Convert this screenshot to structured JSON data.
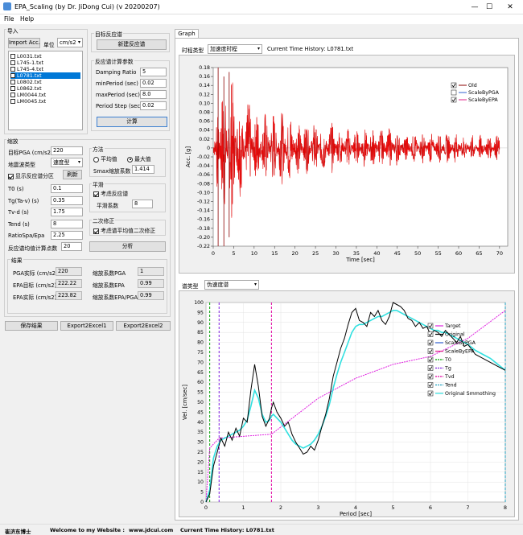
{
  "window": {
    "title": "EPA_Scaling (by Dr. JiDong Cui) (v 20200207)",
    "minimize": "—",
    "maximize": "☐",
    "close": "✕"
  },
  "menu": {
    "file": "File",
    "help": "Help"
  },
  "import": {
    "title": "导入",
    "import_btn": "Import Acc.",
    "unit_label": "单位",
    "unit_value": "cm/s2",
    "files": [
      {
        "name": "L0031.txt",
        "selected": false
      },
      {
        "name": "L745-1.txt",
        "selected": false
      },
      {
        "name": "L745-4.txt",
        "selected": false
      },
      {
        "name": "L0781.txt",
        "selected": true
      },
      {
        "name": "L0802.txt",
        "selected": false
      },
      {
        "name": "L0862.txt",
        "selected": false
      },
      {
        "name": "LM0044.txt",
        "selected": false
      },
      {
        "name": "LM0045.txt",
        "selected": false
      }
    ]
  },
  "target_spectrum": {
    "title": "目标反应谱",
    "new_btn": "新建反应谱"
  },
  "spec_params": {
    "title": "反应谱计算参数",
    "rows": [
      {
        "label": "Damping Ratio",
        "value": "5"
      },
      {
        "label": "minPeriod (sec)",
        "value": "0.02"
      },
      {
        "label": "maxPeriod (sec)",
        "value": "8.0"
      },
      {
        "label": "Period Step (sec)",
        "value": "0.02"
      }
    ],
    "calc_btn": "计算"
  },
  "scaling": {
    "title": "缩放",
    "target_pga_label": "目标PGA (cm/s2)",
    "target_pga": "220",
    "type_label": "地震波类型",
    "type_value": "速度型",
    "show_zone": "显示反应谱分区",
    "refresh_btn": "刷新",
    "params": [
      {
        "label": "T0 (s)",
        "value": "0.1"
      },
      {
        "label": "Tg(Ta-v) (s)",
        "value": "0.35"
      },
      {
        "label": "Tv-d (s)",
        "value": "1.75"
      },
      {
        "label": "Tend (s)",
        "value": "8"
      },
      {
        "label": "RatioSpa/Epa",
        "value": "2.25"
      }
    ],
    "npts_label": "反应谱均值计算点数",
    "npts": "20",
    "analyze_btn": "分析"
  },
  "method": {
    "title": "方法",
    "avg": "平均值",
    "max": "最大值",
    "smax_label": "Smax缩放系数",
    "smax": "1.414"
  },
  "smooth": {
    "title": "平滑",
    "consider": "考虑反应谱",
    "coef_label": "平滑系数",
    "coef": "8"
  },
  "secondary": {
    "title": "二次修正",
    "consider": "考虑谱平均值二次修正"
  },
  "results": {
    "title": "结果",
    "rows": [
      {
        "l1": "PGA实际 (cm/s2)",
        "v1": "220",
        "l2": "缩放系数PGA",
        "v2": "1"
      },
      {
        "l1": "EPA目标 (cm/s2)",
        "v1": "222.22",
        "l2": "缩放系数EPA",
        "v2": "0.99"
      },
      {
        "l1": "EPA实际 (cm/s2)",
        "v1": "223.82",
        "l2": "缩放系数EPA/PGA",
        "v2": "0.99"
      }
    ]
  },
  "bottom_buttons": {
    "save": "保存结果",
    "excel1": "Export2Excel1",
    "excel2": "Export2Excel2"
  },
  "graph": {
    "tab": "Graph",
    "history_type_label": "时程类型",
    "history_type": "加速度时程",
    "current_history": "Current Time History: L0781.txt",
    "spectrum_type_label": "谱类型",
    "spectrum_type": "伪速度谱"
  },
  "chart_data": [
    {
      "type": "line",
      "xlabel": "Time [sec]",
      "ylabel": "Acc. [g]",
      "xlim": [
        0,
        72
      ],
      "ylim": [
        -0.22,
        0.18
      ],
      "xticks": [
        0,
        5,
        10,
        15,
        20,
        25,
        30,
        35,
        40,
        45,
        50,
        55,
        60,
        65,
        70
      ],
      "yticks": [
        -0.22,
        -0.2,
        -0.18,
        -0.16,
        -0.14,
        -0.12,
        -0.1,
        -0.08,
        -0.06,
        -0.04,
        -0.02,
        0,
        0.02,
        0.04,
        0.06,
        0.08,
        0.1,
        0.12,
        0.14,
        0.16,
        0.18
      ],
      "legend_position": "top-right",
      "series": [
        {
          "name": "Old",
          "color": "#8b0000"
        },
        {
          "name": "ScaleByPGA",
          "color": "#3060d0"
        },
        {
          "name": "ScaleByEPA",
          "color": "#e0208a"
        }
      ],
      "colors": {
        "old": "#8b0000",
        "epa": "#ff1010"
      }
    },
    {
      "type": "line",
      "xlabel": "Period [sec]",
      "ylabel": "Vel. [cm/sec]",
      "xlim": [
        0,
        8
      ],
      "ylim": [
        0,
        100
      ],
      "xticks": [
        0,
        1,
        2,
        3,
        4,
        5,
        6,
        7,
        8
      ],
      "yticks": [
        0,
        5,
        10,
        15,
        20,
        25,
        30,
        35,
        40,
        45,
        50,
        55,
        60,
        65,
        70,
        75,
        80,
        85,
        90,
        95,
        100
      ],
      "legend_position": "right",
      "series": [
        {
          "name": "Target",
          "color": "#e020e0"
        },
        {
          "name": "Original",
          "color": "#000000"
        },
        {
          "name": "ScaleByPGA",
          "color": "#3060d0"
        },
        {
          "name": "ScaleByEPA",
          "color": "#e0208a"
        },
        {
          "name": "T0",
          "color": "#00a000"
        },
        {
          "name": "Tg",
          "color": "#8020e0"
        },
        {
          "name": "Tvd",
          "color": "#e000a0"
        },
        {
          "name": "Tend",
          "color": "#20a0c0"
        },
        {
          "name": "Original Smmothing",
          "color": "#30e0e0"
        }
      ],
      "target": {
        "x": [
          0,
          0.1,
          0.35,
          1.75,
          3,
          4,
          5,
          6,
          7,
          8
        ],
        "y": [
          0,
          27,
          32,
          34,
          52,
          62,
          69,
          73,
          82,
          96
        ]
      },
      "original": {
        "x": [
          0,
          0.1,
          0.2,
          0.3,
          0.4,
          0.5,
          0.6,
          0.7,
          0.8,
          0.9,
          1.0,
          1.1,
          1.2,
          1.3,
          1.4,
          1.5,
          1.6,
          1.7,
          1.75,
          1.8,
          1.9,
          2.0,
          2.1,
          2.2,
          2.3,
          2.4,
          2.5,
          2.6,
          2.7,
          2.8,
          2.9,
          3.0,
          3.1,
          3.2,
          3.3,
          3.4,
          3.5,
          3.6,
          3.7,
          3.8,
          3.9,
          4.0,
          4.1,
          4.2,
          4.3,
          4.4,
          4.5,
          4.6,
          4.7,
          4.8,
          4.9,
          5.0,
          5.1,
          5.2,
          5.3,
          5.4,
          5.5,
          5.6,
          5.7,
          5.8,
          5.9,
          6.0,
          6.1,
          6.2,
          6.3,
          6.4,
          6.5,
          6.6,
          6.7,
          6.8,
          6.9,
          7.0,
          7.2,
          7.4,
          7.6,
          7.8,
          8.0
        ],
        "y": [
          0,
          4,
          18,
          25,
          32,
          28,
          35,
          31,
          37,
          33,
          42,
          40,
          56,
          69,
          58,
          43,
          38,
          42,
          47,
          50,
          45,
          42,
          38,
          40,
          34,
          30,
          27,
          24,
          25,
          28,
          26,
          31,
          38,
          44,
          52,
          63,
          70,
          77,
          82,
          89,
          95,
          97,
          91,
          90,
          88,
          95,
          93,
          96,
          91,
          89,
          93,
          100,
          99,
          98,
          96,
          92,
          91,
          88,
          90,
          87,
          88,
          84,
          86,
          85,
          83,
          86,
          84,
          82,
          80,
          83,
          78,
          79,
          74,
          72,
          70,
          68,
          66
        ],
        "smooth": [
          0,
          6,
          22,
          28,
          31,
          32,
          33,
          34,
          35,
          36,
          38,
          41,
          48,
          56,
          52,
          44,
          40,
          41,
          43,
          44,
          42,
          40,
          37,
          34,
          31,
          29,
          28,
          27,
          28,
          29,
          31,
          34,
          38,
          43,
          49,
          57,
          64,
          70,
          75,
          80,
          85,
          88,
          89,
          89,
          90,
          91,
          92,
          93,
          93,
          94,
          95,
          96,
          96,
          95,
          94,
          93,
          92,
          91,
          90,
          89,
          88,
          87,
          86,
          86,
          85,
          85,
          84,
          83,
          82,
          81,
          80,
          79,
          76,
          74,
          72,
          69,
          66
        ]
      }
    }
  ]
}
